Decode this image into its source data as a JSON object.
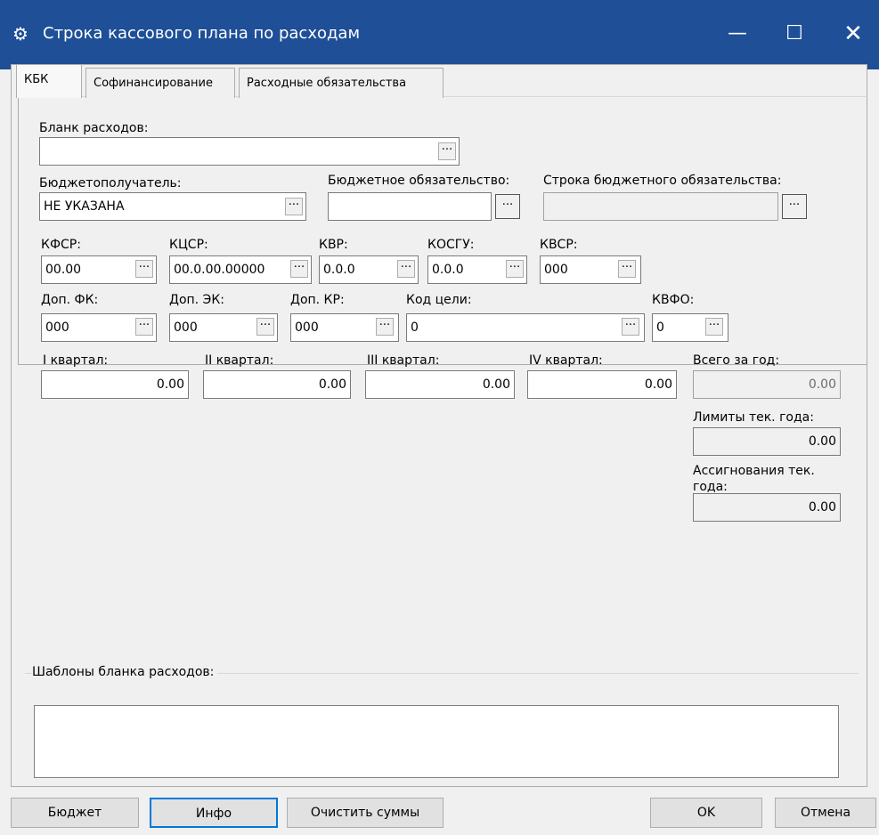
{
  "window": {
    "title": "Строка кассового плана по расходам",
    "icon": "app-icon",
    "minimize": "—",
    "maximize": "☐",
    "close": "✕"
  },
  "tabs": [
    "КБК",
    "Софинансирование",
    "Расходные обязательства"
  ],
  "fields": {
    "blank_label": "Бланк расходов:",
    "blank_value": "",
    "recipient_label": "Бюджетополучатель:",
    "recipient_value": "НЕ УКАЗАНА",
    "obligation_label": "Бюджетное обязательство:",
    "obligation_value": "",
    "obligation_row_label": "Строка бюджетного обязательства:",
    "obligation_row_value": "",
    "kfsr_label": "КФСР:",
    "kfsr_value": "00.00",
    "kcsr_label": "КЦСР:",
    "kcsr_value": "00.0.00.00000",
    "kvr_label": "КВР:",
    "kvr_value": "0.0.0",
    "kosgu_label": "КОСГУ:",
    "kosgu_value": "0.0.0",
    "kvsr_label": "КВСР:",
    "kvsr_value": "000",
    "dop_fk_label": "Доп. ФК:",
    "dop_fk_value": "000",
    "dop_ek_label": "Доп. ЭК:",
    "dop_ek_value": "000",
    "dop_kr_label": "Доп. КР:",
    "dop_kr_value": "000",
    "goal_label": "Код цели:",
    "goal_value": "0",
    "kvfo_label": "КВФО:",
    "kvfo_value": "0",
    "q1_label": "I квартал:",
    "q1_value": "0.00",
    "q2_label": "II квартал:",
    "q2_value": "0.00",
    "q3_label": "III квартал:",
    "q3_value": "0.00",
    "q4_label": "IV квартал:",
    "q4_value": "0.00",
    "year_total_label": "Всего за год:",
    "year_total_value": "0.00",
    "limits_label": "Лимиты тек. года:",
    "limits_value": "0.00",
    "assign_label_1": "Ассигнования тек.",
    "assign_label_2": "года:",
    "assign_value": "0.00"
  },
  "ellipsis": "···",
  "templates": {
    "label": "Шаблоны бланка расходов:",
    "content": ""
  },
  "buttons": {
    "budget": "Бюджет",
    "info": "Инфо",
    "clear": "Очистить суммы",
    "ok": "OK",
    "cancel": "Отмена"
  },
  "colors": {
    "titlebar": "#1e4f97",
    "focus": "#0078d7"
  }
}
